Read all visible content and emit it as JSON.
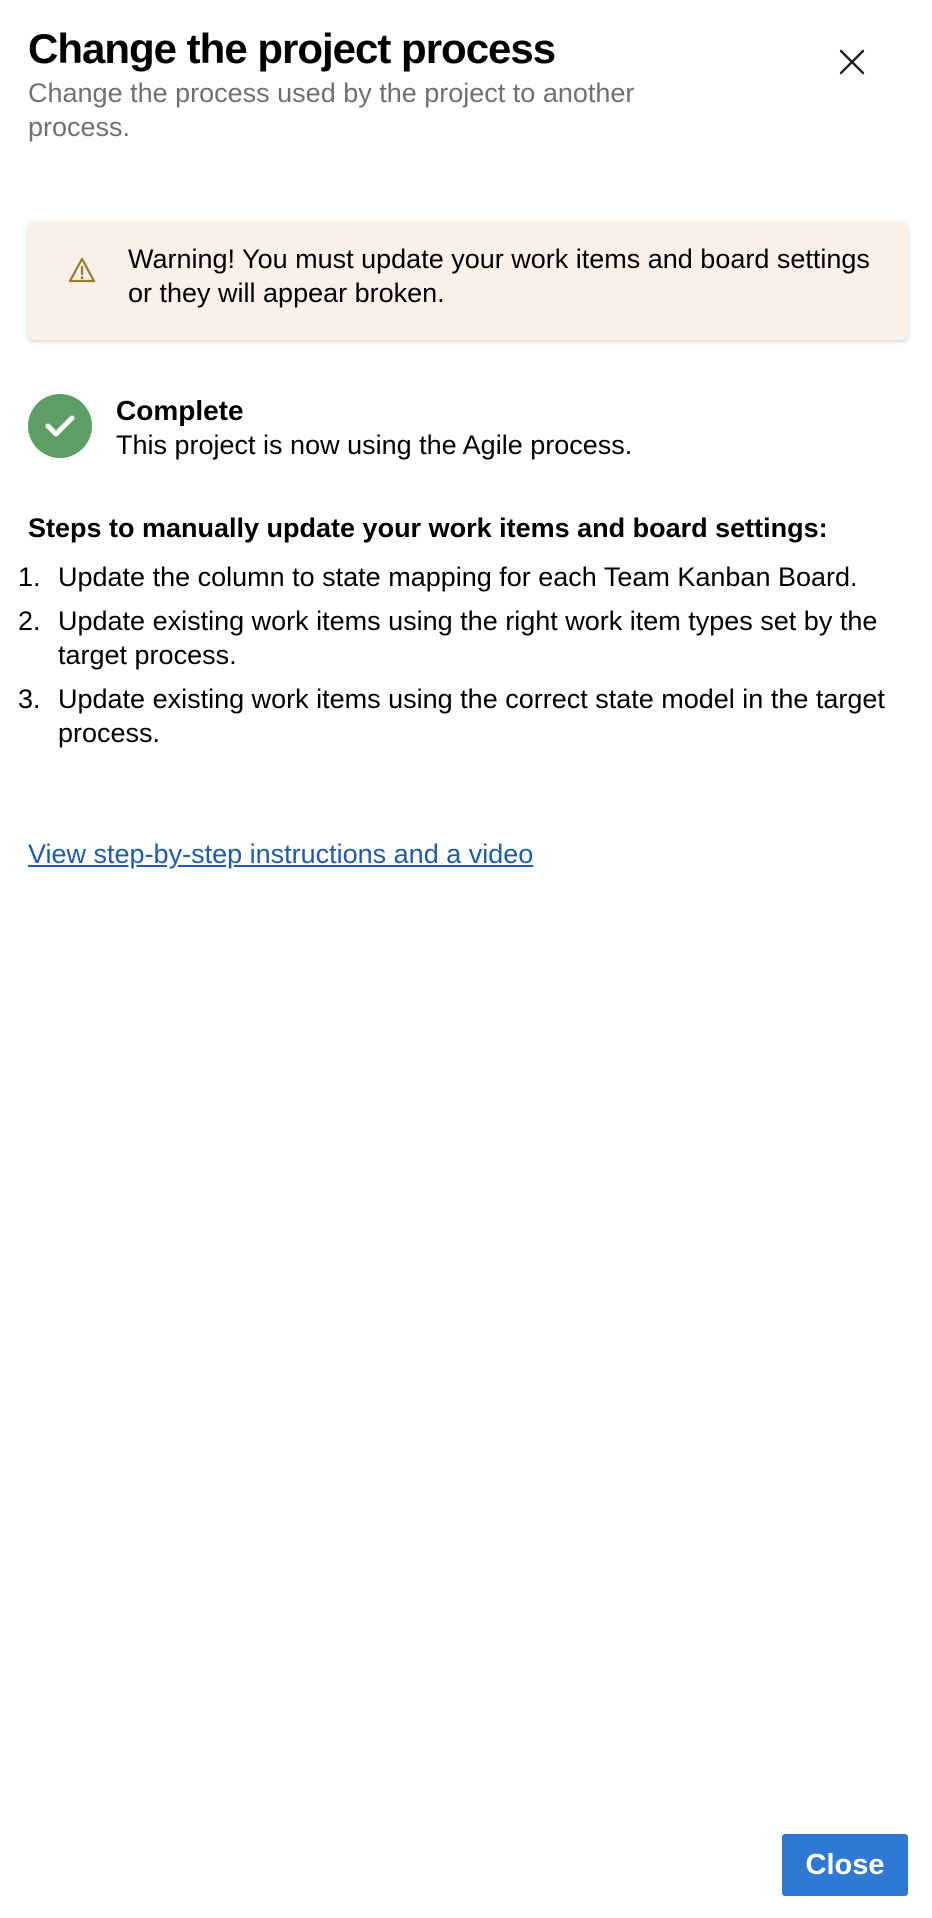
{
  "dialog": {
    "title": "Change the project process",
    "subtitle": "Change the process used by the project to another process.",
    "close_icon": "close-icon"
  },
  "warning": {
    "icon": "warning-icon",
    "text": "Warning! You must update your work items and board settings or they will appear broken.",
    "background_color": "#f9f0ea",
    "icon_color": "#9a7b2d"
  },
  "status": {
    "icon": "checkmark-icon",
    "title": "Complete",
    "description": "This project is now using the Agile process.",
    "color": "#5c9e63"
  },
  "steps": {
    "heading": "Steps to manually update your work items and board settings:",
    "items": [
      {
        "number": "1.",
        "text": "Update the column to state mapping for each Team Kanban Board."
      },
      {
        "number": "2.",
        "text": "Update existing work items using the right work item types set by the target process."
      },
      {
        "number": "3.",
        "text": "Update existing work items using the correct state model in the target process."
      }
    ]
  },
  "link": {
    "text": "View step-by-step instructions and a video",
    "color": "#1f5ba8"
  },
  "footer": {
    "close_label": "Close",
    "button_color": "#2f79d4"
  }
}
